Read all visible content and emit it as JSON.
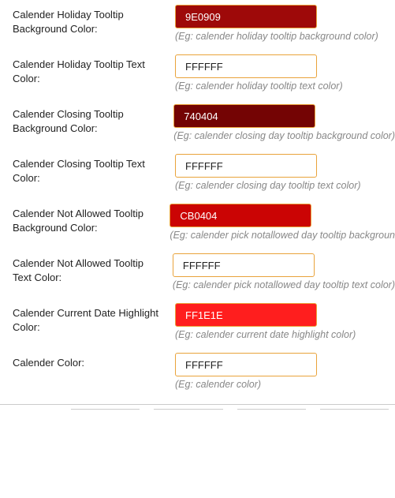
{
  "settings": [
    {
      "label": "Calender Holiday Tooltip Background Color:",
      "value": "9E0909",
      "bg": "#9E0909",
      "text_on_dark": true,
      "hint": "(Eg: calender holiday tooltip background color)",
      "name": "holiday-tooltip-bg"
    },
    {
      "label": "Calender Holiday Tooltip Text Color:",
      "value": "FFFFFF",
      "bg": "#FFFFFF",
      "text_on_dark": false,
      "hint": "(Eg: calender holiday tooltip text color)",
      "name": "holiday-tooltip-text"
    },
    {
      "label": "Calender Closing Tooltip Background Color:",
      "value": "740404",
      "bg": "#740404",
      "text_on_dark": true,
      "hint": "(Eg: calender closing day tooltip background color)",
      "name": "closing-tooltip-bg"
    },
    {
      "label": "Calender Closing Tooltip Text Color:",
      "value": "FFFFFF",
      "bg": "#FFFFFF",
      "text_on_dark": false,
      "hint": "(Eg: calender closing day tooltip text color)",
      "name": "closing-tooltip-text"
    },
    {
      "label": "Calender Not Allowed Tooltip Background Color:",
      "value": "CB0404",
      "bg": "#CB0404",
      "text_on_dark": true,
      "hint": "(Eg: calender pick notallowed day tooltip backgroun",
      "name": "notallowed-tooltip-bg"
    },
    {
      "label": "Calender Not Allowed Tooltip Text Color:",
      "value": "FFFFFF",
      "bg": "#FFFFFF",
      "text_on_dark": false,
      "hint": "(Eg: calender pick notallowed day tooltip text color)",
      "name": "notallowed-tooltip-text"
    },
    {
      "label": "Calender Current Date Highlight Color:",
      "value": "FF1E1E",
      "bg": "#FF1E1E",
      "text_on_dark": true,
      "hint": "(Eg: calender current date highlight color)",
      "name": "current-date-highlight"
    },
    {
      "label": "Calender Color:",
      "value": "FFFFFF",
      "bg": "#FFFFFF",
      "text_on_dark": false,
      "hint": "(Eg: calender color)",
      "name": "calendar-color"
    }
  ]
}
